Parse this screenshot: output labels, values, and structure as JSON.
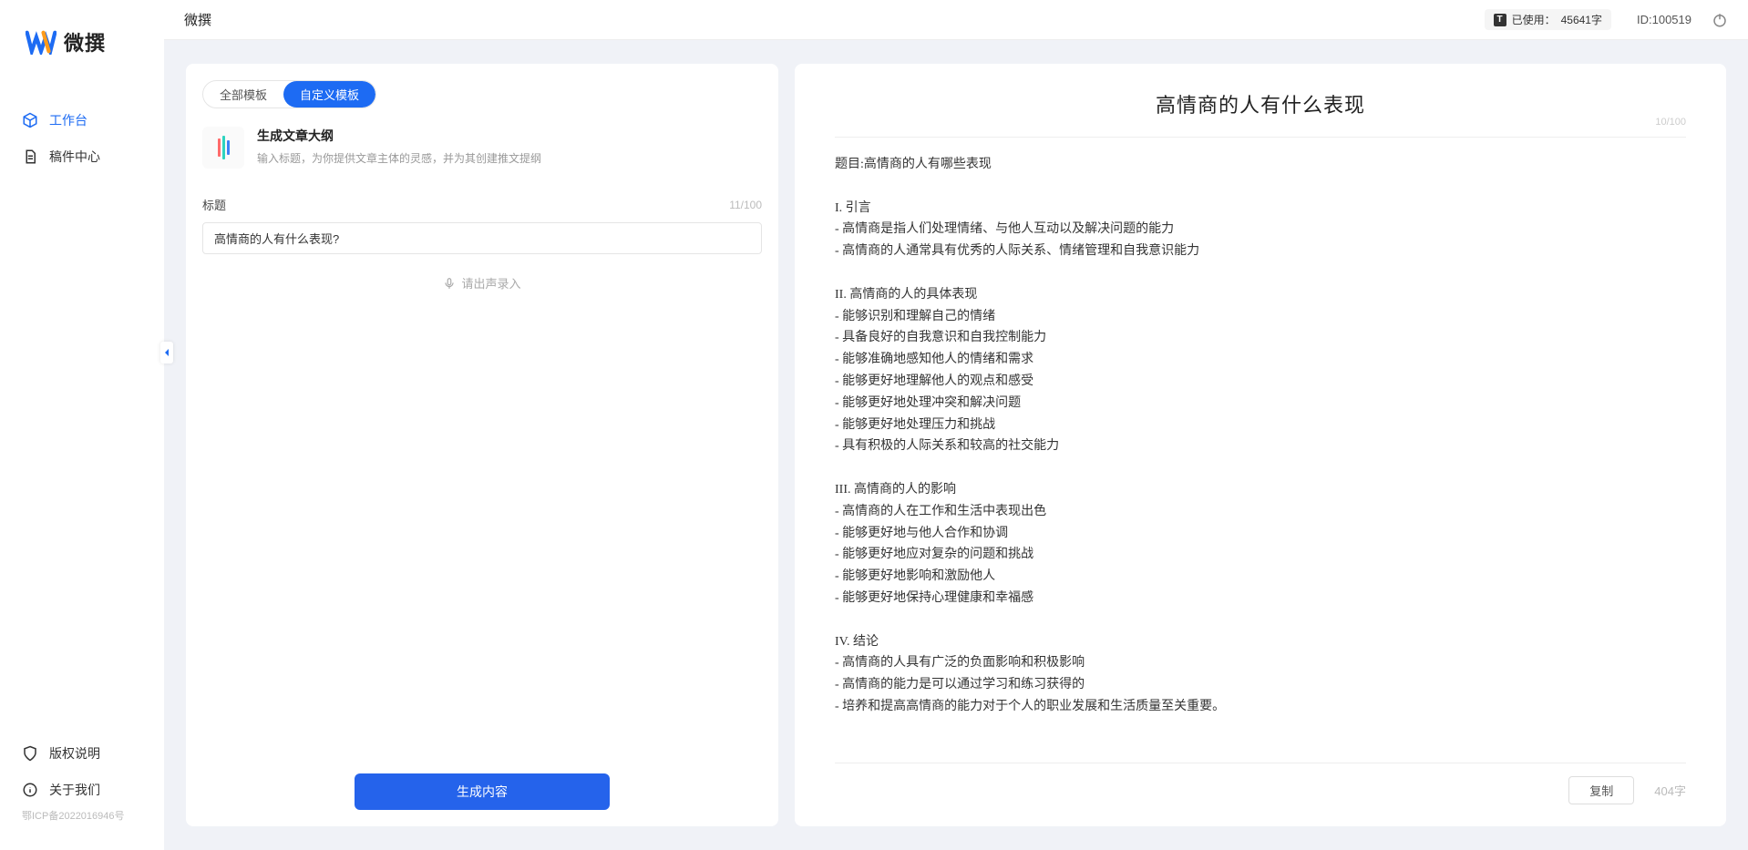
{
  "app": {
    "name": "微撰"
  },
  "sidebar": {
    "items": [
      {
        "label": "工作台"
      },
      {
        "label": "稿件中心"
      }
    ],
    "bottom": [
      {
        "label": "版权说明"
      },
      {
        "label": "关于我们"
      }
    ],
    "icp": "鄂ICP备2022016946号"
  },
  "topbar": {
    "title": "微撰",
    "usage_label": "已使用：",
    "usage_value": "45641字",
    "id_label": "ID:",
    "id_value": "100519"
  },
  "tabs": {
    "all": "全部模板",
    "custom": "自定义模板"
  },
  "template": {
    "name": "生成文章大纲",
    "desc": "输入标题，为你提供文章主体的灵感，并为其创建推文提纲"
  },
  "form": {
    "title_label": "标题",
    "title_count": "11/100",
    "title_value": "高情商的人有什么表现?",
    "voice_label": "请出声录入",
    "generate": "生成内容"
  },
  "output": {
    "title": "高情商的人有什么表现",
    "title_count": "10/100",
    "body": "题目:高情商的人有哪些表现\n\nI. 引言\n- 高情商是指人们处理情绪、与他人互动以及解决问题的能力\n- 高情商的人通常具有优秀的人际关系、情绪管理和自我意识能力\n\nII. 高情商的人的具体表现\n- 能够识别和理解自己的情绪\n- 具备良好的自我意识和自我控制能力\n- 能够准确地感知他人的情绪和需求\n- 能够更好地理解他人的观点和感受\n- 能够更好地处理冲突和解决问题\n- 能够更好地处理压力和挑战\n- 具有积极的人际关系和较高的社交能力\n\nIII. 高情商的人的影响\n- 高情商的人在工作和生活中表现出色\n- 能够更好地与他人合作和协调\n- 能够更好地应对复杂的问题和挑战\n- 能够更好地影响和激励他人\n- 能够更好地保持心理健康和幸福感\n\nIV. 结论\n- 高情商的人具有广泛的负面影响和积极影响\n- 高情商的能力是可以通过学习和练习获得的\n- 培养和提高高情商的能力对于个人的职业发展和生活质量至关重要。",
    "copy": "复制",
    "char_count": "404字"
  }
}
